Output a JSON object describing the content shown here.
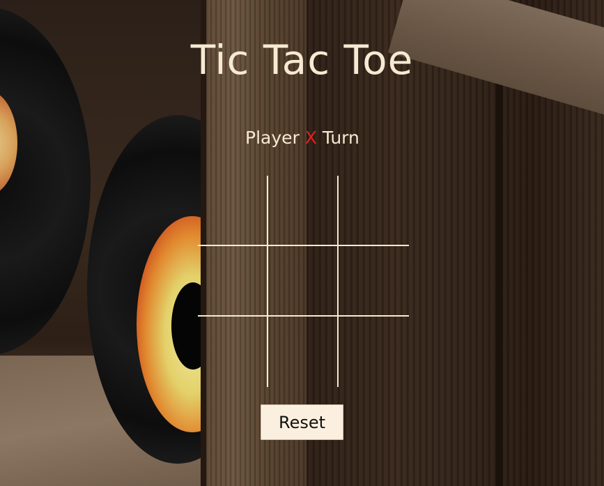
{
  "game": {
    "title": "Tic Tac Toe",
    "turn_prefix": "Player",
    "current_player": "X",
    "turn_suffix": "Turn",
    "board": [
      "",
      "",
      "",
      "",
      "",
      "",
      "",
      "",
      ""
    ],
    "reset_label": "Reset"
  },
  "colors": {
    "text": "#f7ead3",
    "current_player": "#e41f1f",
    "grid_lines": "#f7ead3",
    "button_bg": "#fbf0df",
    "button_text": "#111111"
  }
}
